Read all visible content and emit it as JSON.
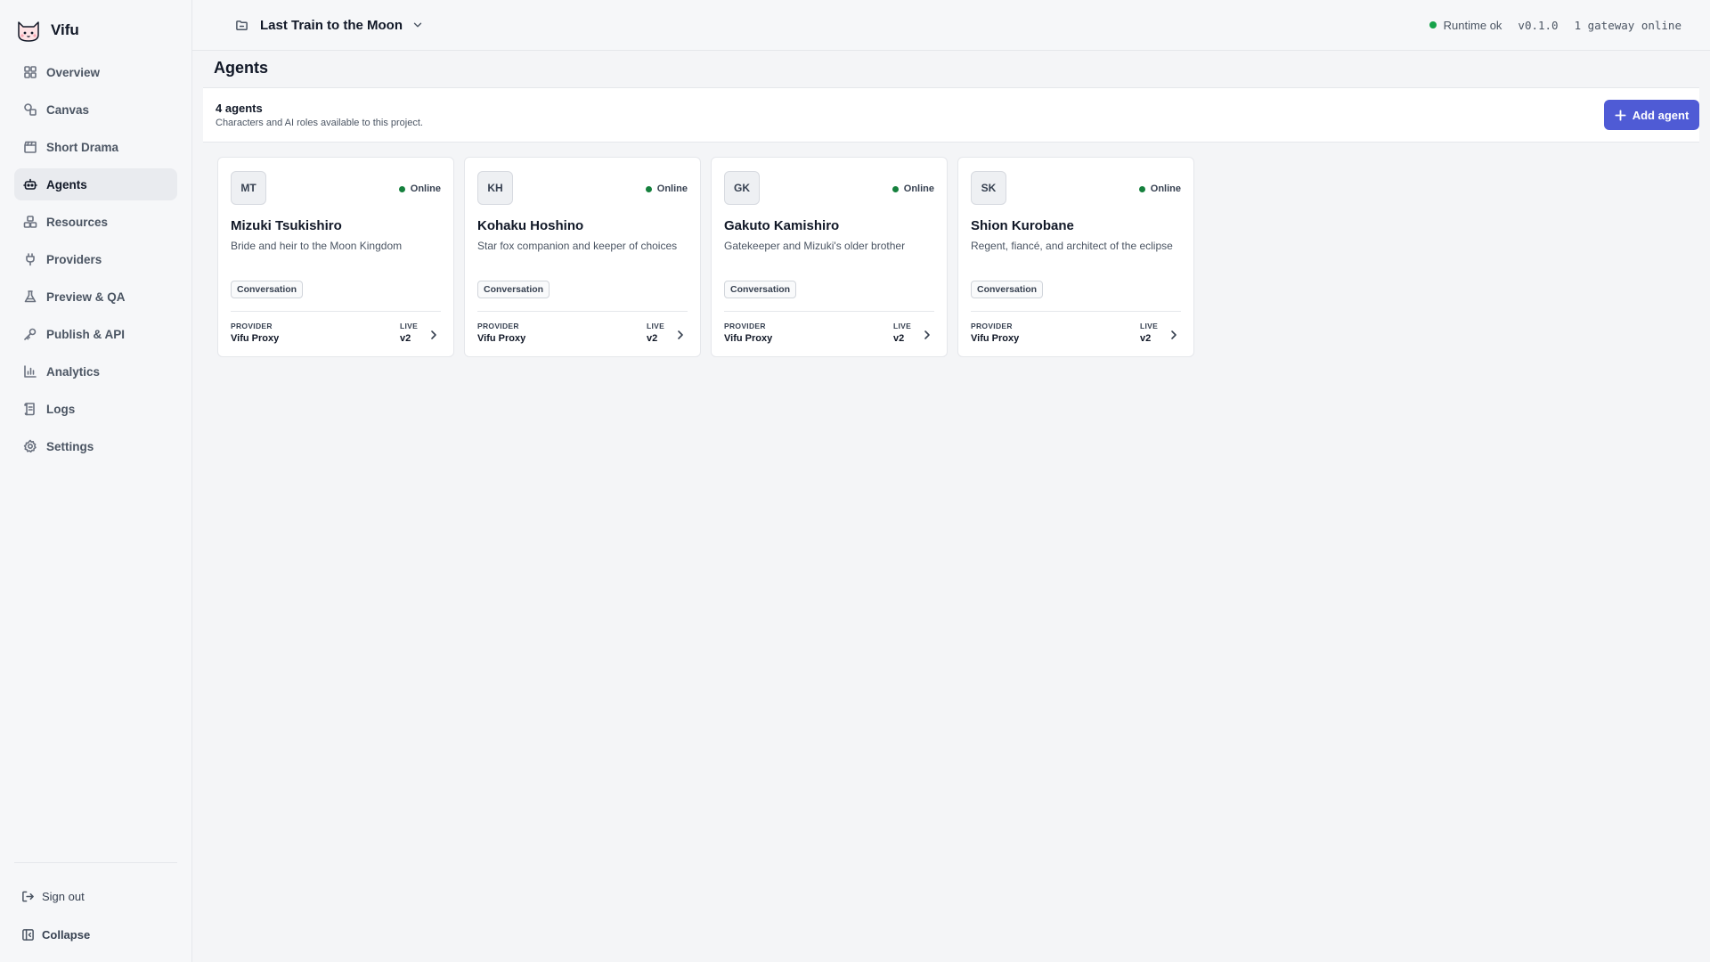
{
  "app": {
    "name": "Vifu"
  },
  "sidebar": {
    "items": [
      {
        "label": "Overview",
        "icon": "grid-icon"
      },
      {
        "label": "Canvas",
        "icon": "shapes-icon"
      },
      {
        "label": "Short Drama",
        "icon": "clapperboard-icon"
      },
      {
        "label": "Agents",
        "icon": "bot-icon",
        "active": true
      },
      {
        "label": "Resources",
        "icon": "boxes-icon"
      },
      {
        "label": "Providers",
        "icon": "plug-icon"
      },
      {
        "label": "Preview & QA",
        "icon": "flask-icon"
      },
      {
        "label": "Publish & API",
        "icon": "key-icon"
      },
      {
        "label": "Analytics",
        "icon": "bar-chart-icon"
      },
      {
        "label": "Logs",
        "icon": "scroll-icon"
      },
      {
        "label": "Settings",
        "icon": "gear-icon"
      }
    ],
    "sign_out": "Sign out",
    "collapse": "Collapse"
  },
  "topbar": {
    "project_name": "Last Train to the Moon",
    "runtime": "Runtime ok",
    "version": "v0.1.0",
    "gateway": "1 gateway online"
  },
  "page": {
    "title": "Agents",
    "count": "4 agents",
    "description": "Characters and AI roles available to this project.",
    "add_label": "Add agent"
  },
  "labels": {
    "provider": "PROVIDER",
    "live": "LIVE"
  },
  "agents": [
    {
      "initials": "MT",
      "status": "Online",
      "name": "Mizuki Tsukishiro",
      "description": "Bride and heir to the Moon Kingdom",
      "tag": "Conversation",
      "provider": "Vifu Proxy",
      "live": "v2"
    },
    {
      "initials": "KH",
      "status": "Online",
      "name": "Kohaku Hoshino",
      "description": "Star fox companion and keeper of choices",
      "tag": "Conversation",
      "provider": "Vifu Proxy",
      "live": "v2"
    },
    {
      "initials": "GK",
      "status": "Online",
      "name": "Gakuto Kamishiro",
      "description": "Gatekeeper and Mizuki's older brother",
      "tag": "Conversation",
      "provider": "Vifu Proxy",
      "live": "v2"
    },
    {
      "initials": "SK",
      "status": "Online",
      "name": "Shion Kurobane",
      "description": "Regent, fiancé, and architect of the eclipse",
      "tag": "Conversation",
      "provider": "Vifu Proxy",
      "live": "v2"
    }
  ],
  "colors": {
    "accent": "#4f5bd5",
    "online": "#16a34a"
  }
}
